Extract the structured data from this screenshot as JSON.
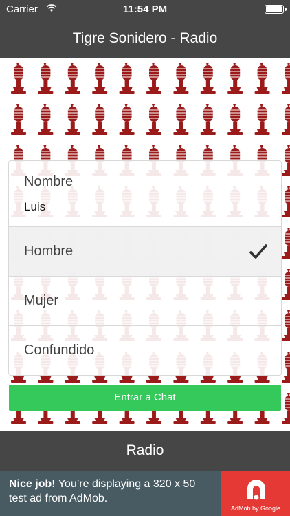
{
  "status_bar": {
    "carrier": "Carrier",
    "time": "11:54 PM",
    "battery_level": 1.0,
    "wifi_icon": "wifi-icon",
    "battery_icon": "battery-icon"
  },
  "nav": {
    "title": "Tigre Sonidero - Radio"
  },
  "background": {
    "pattern_icon": "microphone-icon",
    "color": "#9b1b1b"
  },
  "form": {
    "name_label": "Nombre",
    "name_value": "Luis",
    "options": [
      {
        "label": "Hombre",
        "selected": true
      },
      {
        "label": "Mujer",
        "selected": false
      },
      {
        "label": "Confundido",
        "selected": false
      }
    ],
    "check_icon": "checkmark-icon",
    "submit_label": "Entrar a Chat",
    "submit_color": "#35c85a"
  },
  "tab_bar": {
    "label": "Radio"
  },
  "ad": {
    "headline": "Nice job!",
    "body": " You’re displaying a 320 x 50 test ad from AdMob.",
    "logo_caption": "AdMob by Google",
    "logo_icon": "admob-logo-icon",
    "tile_color": "#e53935",
    "banner_color": "#485b62"
  }
}
